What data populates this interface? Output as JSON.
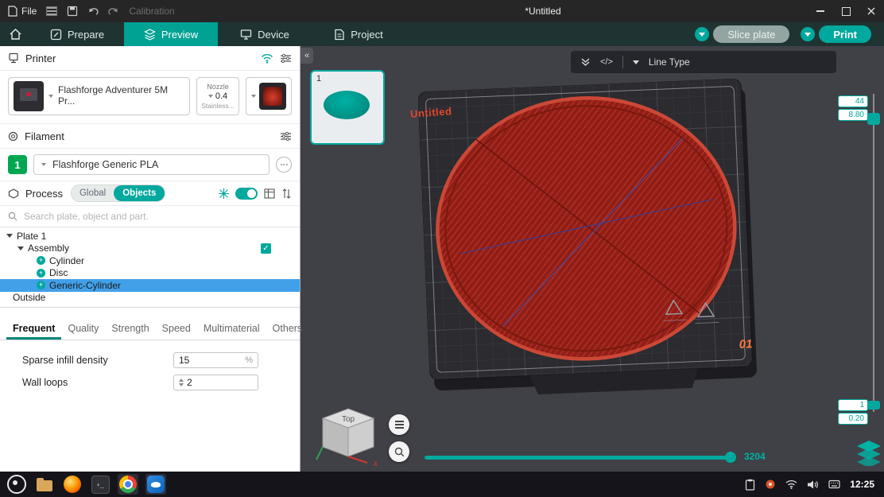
{
  "colors": {
    "accent": "#00A89D",
    "selection": "#42A0E8",
    "disc_red": "#B02A22"
  },
  "titlebar": {
    "file": "File",
    "calibration": "Calibration",
    "title": "*Untitled"
  },
  "nav": {
    "tabs": [
      {
        "label": "Prepare"
      },
      {
        "label": "Preview"
      },
      {
        "label": "Device"
      },
      {
        "label": "Project"
      }
    ],
    "slice": "Slice plate",
    "print": "Print"
  },
  "sidebar": {
    "printer": {
      "header": "Printer",
      "model": "Flashforge Adventurer 5M Pr...",
      "nozzle_title": "Nozzle",
      "nozzle_value": "0.4",
      "nozzle_material": "Stainless..."
    },
    "filament": {
      "header": "Filament",
      "slot": "1",
      "name": "Flashforge Generic PLA"
    },
    "process": {
      "header": "Process",
      "global": "Global",
      "objects": "Objects",
      "search_placeholder": "Search plate, object and part."
    },
    "tree": {
      "items": [
        {
          "label": "Plate 1"
        },
        {
          "label": "Assembly"
        },
        {
          "label": "Cylinder"
        },
        {
          "label": "Disc"
        },
        {
          "label": "Generic-Cylinder"
        },
        {
          "label": "Outside"
        }
      ]
    },
    "tabs": [
      {
        "label": "Frequent"
      },
      {
        "label": "Quality"
      },
      {
        "label": "Strength"
      },
      {
        "label": "Speed"
      },
      {
        "label": "Multimaterial"
      },
      {
        "label": "Others"
      }
    ],
    "params": {
      "sparse_label": "Sparse infill density",
      "sparse_value": "15",
      "sparse_unit": "%",
      "wall_label": "Wall loops",
      "wall_value": "2"
    }
  },
  "viewport": {
    "plate_thumb": "1",
    "code_icon": "</>",
    "line_type": "Line Type",
    "untitled": "Untitled",
    "plate_marker": "01",
    "layer_top_a": "44",
    "layer_top_b": "8.80",
    "layer_bottom_a": "1",
    "layer_bottom_b": "0.20",
    "step_value": "3204",
    "gizmo_top": "Top",
    "axis_x": "x"
  },
  "taskbar": {
    "time": "12:25"
  }
}
